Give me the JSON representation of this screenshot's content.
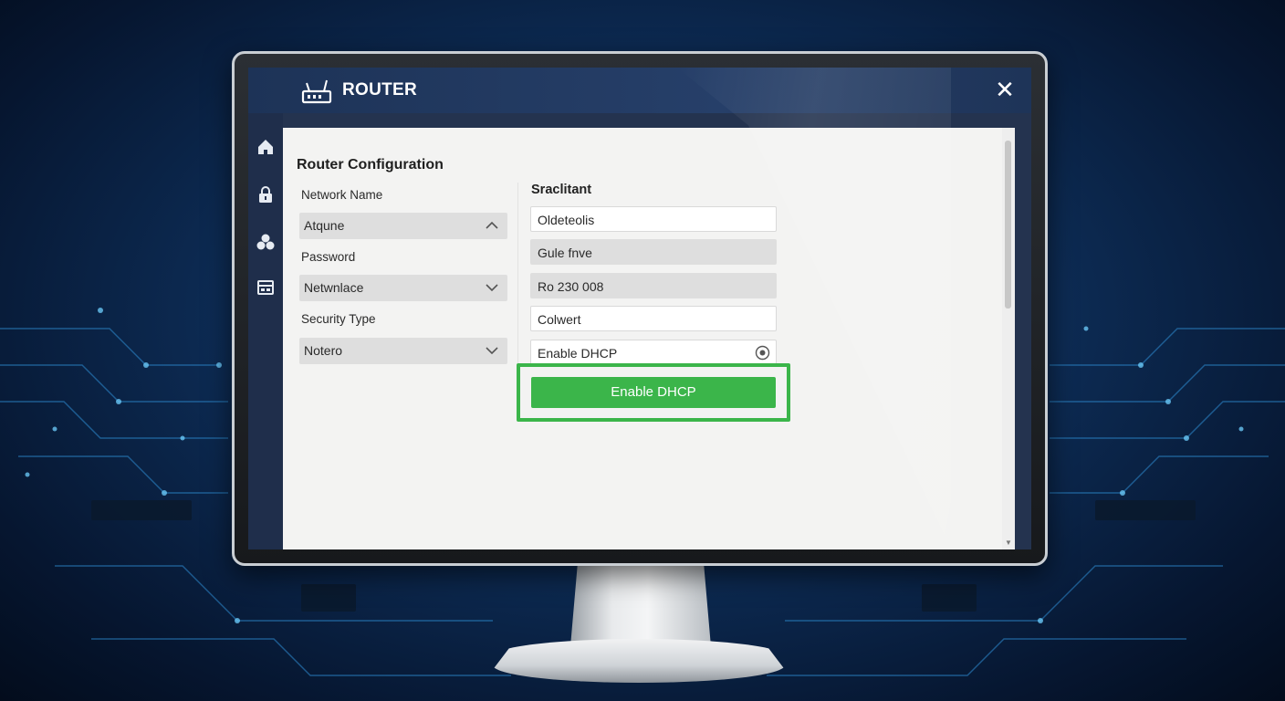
{
  "app": {
    "title": "ROUTER",
    "close_label": "✕"
  },
  "sidebar": {
    "items": [
      {
        "icon": "home-icon"
      },
      {
        "icon": "lock-icon"
      },
      {
        "icon": "devices-icon"
      },
      {
        "icon": "network-panel-icon"
      }
    ]
  },
  "form": {
    "section_title": "Router Configuration",
    "left": [
      {
        "label": "Network Name",
        "value": "Atqune",
        "chevron": "up"
      },
      {
        "label": "Password",
        "value": "Netwnlace",
        "chevron": "down"
      },
      {
        "label": "Security Type",
        "value": "Notero",
        "chevron": "down"
      }
    ],
    "right_title": "Sraclitant",
    "right_fields": [
      {
        "value": "Oldeteolis",
        "style": "white"
      },
      {
        "value": "Gule fnve",
        "style": "grey"
      },
      {
        "value": "Ro 230 008",
        "style": "grey"
      },
      {
        "value": "Colwert",
        "style": "white"
      },
      {
        "value": "Enable DHCP",
        "style": "white"
      }
    ],
    "primary_button": "Enable DHCP"
  },
  "colors": {
    "accent_green": "#3bb54a",
    "titlebar": "#1d3357"
  }
}
